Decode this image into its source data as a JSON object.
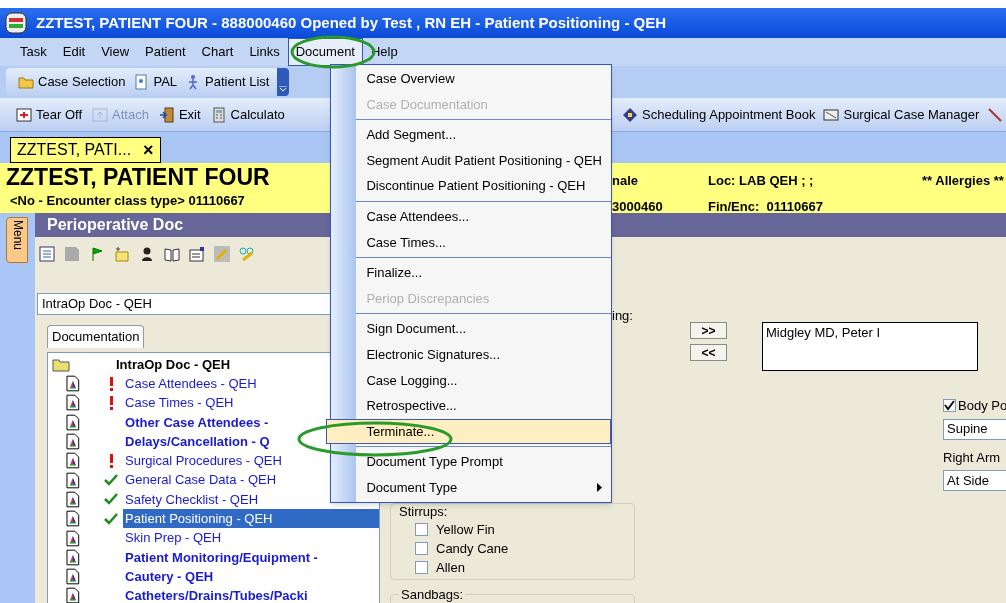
{
  "window": {
    "title": "ZZTEST, PATIENT FOUR - 888000460 Opened by Test , RN EH - Patient Positioning - QEH"
  },
  "menu_bar": [
    {
      "label": "Task",
      "selected": false
    },
    {
      "label": "Edit",
      "selected": false
    },
    {
      "label": "View",
      "selected": false
    },
    {
      "label": "Patient",
      "selected": false
    },
    {
      "label": "Chart",
      "selected": false
    },
    {
      "label": "Links",
      "selected": false
    },
    {
      "label": "Document",
      "selected": true
    },
    {
      "label": "Help",
      "selected": false
    }
  ],
  "toolbar_1": [
    {
      "label": "Case Selection",
      "disabled": false
    },
    {
      "label": "PAL",
      "disabled": false
    },
    {
      "label": "Patient List",
      "disabled": false
    }
  ],
  "toolbar_2": [
    {
      "label": "Tear Off",
      "disabled": false
    },
    {
      "label": "Attach",
      "disabled": true
    },
    {
      "label": "Exit",
      "disabled": false
    },
    {
      "label": "Calculato",
      "disabled": false
    }
  ],
  "toolbar_2_right": [
    {
      "label": "Scheduling Appointment Book",
      "disabled": false
    },
    {
      "label": "Surgical Case Manager",
      "disabled": false
    }
  ],
  "patient_tab": {
    "label": "ZZTEST, PATI...",
    "close": "×"
  },
  "banner": {
    "name": "ZZTEST, PATIENT FOUR",
    "encounter": "<No - Encounter class type> 01110667",
    "column_2": [
      "nale",
      "3000460"
    ],
    "location": "Loc: LAB QEH ; ;",
    "fin": "Fin/Enc:  01110667",
    "allergies": "** Allergies **"
  },
  "side_tab": "Menu",
  "panel_title": "Perioperative Doc",
  "doc_dropdown": {
    "value": "IntraOp Doc - QEH"
  },
  "doc_tabs": [
    {
      "label": "Documentation",
      "selected": true
    }
  ],
  "tree": {
    "label": "IntraOp Doc - QEH",
    "children": [
      {
        "label": "Case Attendees - QEH",
        "kind": "required",
        "bold": false,
        "selected": false
      },
      {
        "label": "Case Times - QEH",
        "kind": "required",
        "bold": false,
        "selected": false
      },
      {
        "label": "Other Case Attendees -",
        "kind": "plain",
        "bold": true,
        "selected": false
      },
      {
        "label": "Delays/Cancellation - Q",
        "kind": "plain",
        "bold": true,
        "selected": false
      },
      {
        "label": "Surgical Procedures - QEH",
        "kind": "required",
        "bold": false,
        "selected": false
      },
      {
        "label": "General Case Data - QEH",
        "kind": "complete",
        "bold": false,
        "selected": false
      },
      {
        "label": "Safety Checklist - QEH",
        "kind": "complete",
        "bold": false,
        "selected": false
      },
      {
        "label": "Patient Positioning - QEH",
        "kind": "complete",
        "bold": false,
        "selected": true
      },
      {
        "label": "Skin Prep - QEH",
        "kind": "plain",
        "bold": false,
        "selected": false
      },
      {
        "label": "Patient Monitoring/Equipment -",
        "kind": "plain",
        "bold": true,
        "selected": false
      },
      {
        "label": "Cautery - QEH",
        "kind": "plain",
        "bold": true,
        "selected": false
      },
      {
        "label": "Catheters/Drains/Tubes/Packi",
        "kind": "plain",
        "bold": true,
        "selected": false
      }
    ]
  },
  "form": {
    "label_fragment": "ing:",
    "move_buttons": [
      ">>",
      "<<"
    ],
    "assigned_list": [
      "Midgley MD, Peter I"
    ],
    "body_position": {
      "label": "Body Po",
      "checked": true,
      "value": "Supine"
    },
    "right_arm": {
      "label": "Right Arm",
      "value": "At Side"
    },
    "stirrups": {
      "label": "Stirrups:",
      "options": [
        {
          "label": "Yellow Fin",
          "checked": false
        },
        {
          "label": "Candy Cane",
          "checked": false
        },
        {
          "label": "Allen",
          "checked": false
        }
      ]
    },
    "sandbags": {
      "label": "Sandbags:"
    }
  },
  "context_menu": [
    {
      "kind": "item",
      "label": "Case Overview",
      "disabled": false,
      "selected": false,
      "submenu": false
    },
    {
      "kind": "item",
      "label": "Case Documentation",
      "disabled": true,
      "selected": false,
      "submenu": false
    },
    {
      "kind": "separator"
    },
    {
      "kind": "item",
      "label": "Add Segment...",
      "disabled": false,
      "selected": false,
      "submenu": false
    },
    {
      "kind": "item",
      "label": "Segment Audit Patient Positioning - QEH",
      "disabled": false,
      "selected": false,
      "submenu": false
    },
    {
      "kind": "item",
      "label": "Discontinue Patient Positioning - QEH",
      "disabled": false,
      "selected": false,
      "submenu": false
    },
    {
      "kind": "separator"
    },
    {
      "kind": "item",
      "label": "Case Attendees...",
      "disabled": false,
      "selected": false,
      "submenu": false
    },
    {
      "kind": "item",
      "label": "Case Times...",
      "disabled": false,
      "selected": false,
      "submenu": false
    },
    {
      "kind": "separator"
    },
    {
      "kind": "item",
      "label": "Finalize...",
      "disabled": false,
      "selected": false,
      "submenu": false
    },
    {
      "kind": "item",
      "label": "Periop Discrepancies",
      "disabled": true,
      "selected": false,
      "submenu": false
    },
    {
      "kind": "separator"
    },
    {
      "kind": "item",
      "label": "Sign Document...",
      "disabled": false,
      "selected": false,
      "submenu": false
    },
    {
      "kind": "item",
      "label": "Electronic Signatures...",
      "disabled": false,
      "selected": false,
      "submenu": false
    },
    {
      "kind": "item",
      "label": "Case Logging...",
      "disabled": false,
      "selected": false,
      "submenu": false
    },
    {
      "kind": "item",
      "label": "Retrospective...",
      "disabled": false,
      "selected": false,
      "submenu": false
    },
    {
      "kind": "item",
      "label": "Terminate...",
      "disabled": false,
      "selected": true,
      "submenu": false
    },
    {
      "kind": "separator"
    },
    {
      "kind": "item",
      "label": "Document Type Prompt",
      "disabled": false,
      "selected": false,
      "submenu": false
    },
    {
      "kind": "item",
      "label": "Document Type",
      "disabled": false,
      "selected": false,
      "submenu": true
    }
  ]
}
